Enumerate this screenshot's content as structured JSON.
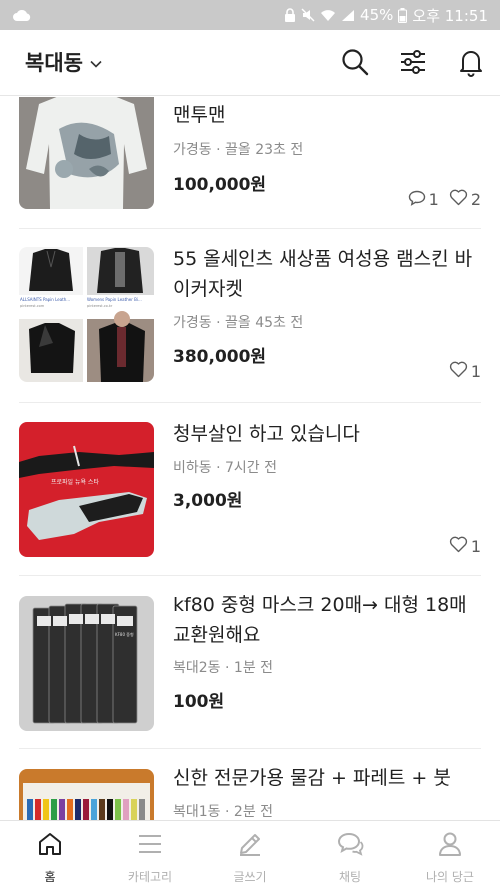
{
  "status_bar": {
    "battery": "45%",
    "time": "오후 11:51",
    "icons": [
      "cloud-icon",
      "lock-icon",
      "mute-icon",
      "wifi-icon",
      "signal-icon",
      "battery-icon"
    ]
  },
  "header": {
    "location": "복대동",
    "icons": [
      "chevron-down-icon",
      "search-icon",
      "filter-icon",
      "bell-icon"
    ]
  },
  "items": [
    {
      "title": "맨투맨",
      "location": "가경동",
      "time": "끌올 23초 전",
      "price": "100,000원",
      "comments": "1",
      "likes": "2"
    },
    {
      "title": "55  올세인츠 새상품 여성용 램스킨 바이커자켓",
      "location": "가경동",
      "time": "끌올 45초 전",
      "price": "380,000원",
      "likes": "1"
    },
    {
      "title": "청부살인 하고 있습니다",
      "location": "비하동",
      "time": "7시간 전",
      "price": "3,000원",
      "likes": "1"
    },
    {
      "title": "kf80 중형 마스크 20매→ 대형 18매 교환원해요",
      "location": "복대2동",
      "time": "1분 전",
      "price": "100원"
    },
    {
      "title": "신한 전문가용 물감 + 파레트 + 붓",
      "location": "복대1동",
      "time": "2분 전"
    }
  ],
  "thumb_text": {
    "jacket_caption_1": "ALLSAINTS Papin Leath...",
    "jacket_caption_2": "Womens Papin Leather Bi...",
    "jacket_site_1": "pinterest.com",
    "jacket_site_2": "pinterest.co.kr",
    "poster_text": "프로파일 뉴욕 스타",
    "mask_label": "KF80 중형"
  },
  "meta_separator": "·",
  "bottom_nav": [
    {
      "label": "홈",
      "icon": "home-icon",
      "active": true
    },
    {
      "label": "카테고리",
      "icon": "menu-icon",
      "active": false
    },
    {
      "label": "글쓰기",
      "icon": "pencil-icon",
      "active": false
    },
    {
      "label": "채팅",
      "icon": "chat-icon",
      "active": false
    },
    {
      "label": "나의 당근",
      "icon": "person-icon",
      "active": false
    }
  ],
  "colors": {
    "status_bar_bg": "#c9c9c9",
    "text_primary": "#212121",
    "text_secondary": "#8b8b8b",
    "nav_inactive": "#b0b0b0"
  }
}
